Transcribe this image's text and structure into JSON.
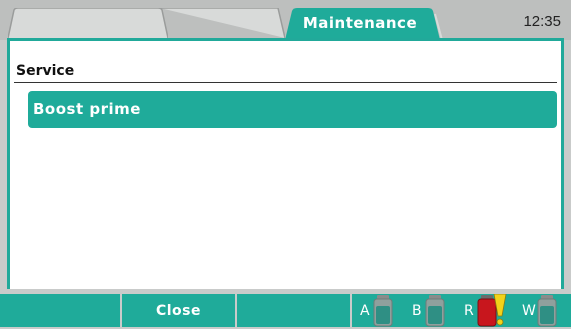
{
  "header": {
    "tabs": [
      {
        "label": "",
        "active": false
      },
      {
        "label": "",
        "active": false
      },
      {
        "label": "Maintenance",
        "active": true
      }
    ],
    "time": "12:35"
  },
  "main": {
    "section_title": "Service",
    "items": [
      {
        "label": "Boost prime"
      }
    ]
  },
  "footer": {
    "buttons": [
      {
        "label": ""
      },
      {
        "label": "Close"
      },
      {
        "label": ""
      }
    ],
    "reservoirs": [
      {
        "letter": "A",
        "state": "ok",
        "icon": "bottle-icon"
      },
      {
        "letter": "B",
        "state": "ok",
        "icon": "bottle-icon"
      },
      {
        "letter": "R",
        "state": "warning",
        "icon": "bottle-warning-icon"
      },
      {
        "letter": "W",
        "state": "ok",
        "icon": "bottle-icon"
      }
    ]
  },
  "colors": {
    "accent": "#1fab9a",
    "warning_bottle": "#c8161d",
    "warning_mark": "#f2d21a"
  }
}
